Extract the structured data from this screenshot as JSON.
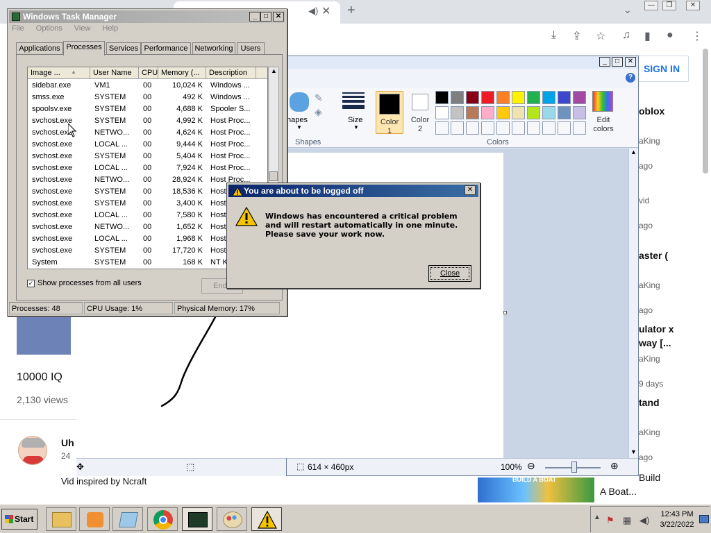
{
  "browser": {
    "sign_in": "SIGN IN",
    "video": {
      "title": "10000 IQ",
      "views": "2,130 views",
      "user": "Uh",
      "date": "24",
      "description": "Vid inspired by Ncraft"
    },
    "recommended": [
      {
        "title": "oblox",
        "channel": "aKing",
        "age": "ago"
      },
      {
        "title": "vid",
        "channel": "",
        "age": "ago"
      },
      {
        "title": "aster (",
        "channel": "aKing",
        "age": "ago"
      },
      {
        "title": "ulator x",
        "title2": "way [...",
        "channel": "aKing",
        "age": "9 days"
      },
      {
        "title": "tand",
        "channel": "aKing",
        "age": "ago"
      }
    ],
    "bottom_card": {
      "thumb_label": "BUILD A BOAT",
      "title_line1": "Build",
      "title_line2": "A Boat..."
    }
  },
  "paint": {
    "groups": {
      "shapes": "Shapes",
      "colors": "Colors"
    },
    "tools": {
      "shapes_label": "hapes",
      "size_label": "Size",
      "color1": "Color",
      "color1_num": "1",
      "color2": "Color",
      "color2_num": "2",
      "edit_colors_1": "Edit",
      "edit_colors_2": "colors"
    },
    "palette_colors": [
      "#000000",
      "#7f7f7f",
      "#880015",
      "#ed1c24",
      "#ff7f27",
      "#fff200",
      "#22b14c",
      "#00a2e8",
      "#3f48cc",
      "#a349a4",
      "#ffffff",
      "#c3c3c3",
      "#b97a57",
      "#ffaec9",
      "#ffc90e",
      "#efe4b0",
      "#b5e61d",
      "#99d9ea",
      "#7092be",
      "#c8bfe7"
    ],
    "status": {
      "dimensions": "614 × 460px",
      "zoom": "100%"
    }
  },
  "taskmgr": {
    "title": "Windows Task Manager",
    "menu": [
      "File",
      "Options",
      "View",
      "Help"
    ],
    "tabs": [
      "Applications",
      "Processes",
      "Services",
      "Performance",
      "Networking",
      "Users"
    ],
    "active_tab": "Processes",
    "columns": [
      "Image ...",
      "User Name",
      "CPU",
      "Memory (...",
      "Description"
    ],
    "rows": [
      [
        "sidebar.exe",
        "VM1",
        "00",
        "10,024 K",
        "Windows ..."
      ],
      [
        "smss.exe",
        "SYSTEM",
        "00",
        "492 K",
        "Windows ..."
      ],
      [
        "spoolsv.exe",
        "SYSTEM",
        "00",
        "4,688 K",
        "Spooler S..."
      ],
      [
        "svchost.exe",
        "SYSTEM",
        "00",
        "4,992 K",
        "Host Proc..."
      ],
      [
        "svchost.exe",
        "NETWO...",
        "00",
        "4,624 K",
        "Host Proc..."
      ],
      [
        "svchost.exe",
        "LOCAL ...",
        "00",
        "9,444 K",
        "Host Proc..."
      ],
      [
        "svchost.exe",
        "SYSTEM",
        "00",
        "5,404 K",
        "Host Proc..."
      ],
      [
        "svchost.exe",
        "LOCAL ...",
        "00",
        "7,924 K",
        "Host Proc..."
      ],
      [
        "svchost.exe",
        "NETWO...",
        "00",
        "28,924 K",
        "Host Proc..."
      ],
      [
        "svchost.exe",
        "SYSTEM",
        "00",
        "18,536 K",
        "Host"
      ],
      [
        "svchost.exe",
        "SYSTEM",
        "00",
        "3,400 K",
        "Host"
      ],
      [
        "svchost.exe",
        "LOCAL ...",
        "00",
        "7,580 K",
        "Host"
      ],
      [
        "svchost.exe",
        "NETWO...",
        "00",
        "1,652 K",
        "Host"
      ],
      [
        "svchost.exe",
        "LOCAL ...",
        "00",
        "1,968 K",
        "Host"
      ],
      [
        "svchost.exe",
        "SYSTEM",
        "00",
        "17,720 K",
        "Host"
      ],
      [
        "System",
        "SYSTEM",
        "00",
        "168 K",
        "NT Ke"
      ]
    ],
    "show_all_label": "Show processes from all users",
    "end_button": "End",
    "status": {
      "processes": "Processes: 48",
      "cpu": "CPU Usage: 1%",
      "memory": "Physical Memory: 17%"
    }
  },
  "dialog": {
    "title": "You are about to be logged off",
    "message": "Windows has encountered a critical problem and will restart automatically in one minute. Please save your work now.",
    "close_button": "Close"
  },
  "taskbar": {
    "start": "Start",
    "time": "12:43 PM",
    "date": "3/22/2022"
  }
}
